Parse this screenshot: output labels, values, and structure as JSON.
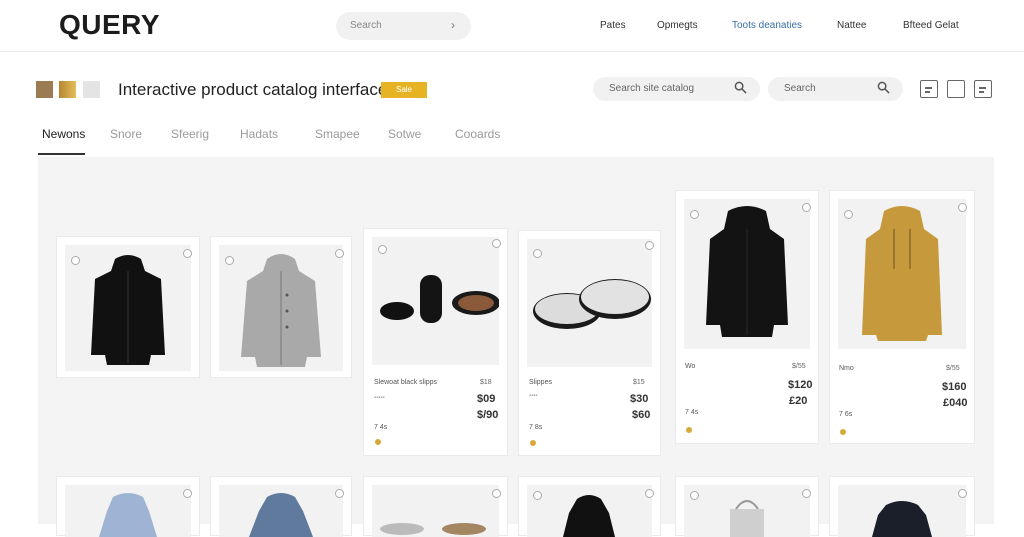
{
  "brand": {
    "logo": "QUERY"
  },
  "top_search": {
    "placeholder": "Search",
    "icon": "arrow-right-icon"
  },
  "nav": {
    "links": [
      {
        "label": "Pates"
      },
      {
        "label": "Opmegts"
      },
      {
        "label": "Toots deanaties"
      },
      {
        "label": "Nattee"
      },
      {
        "label": "Bfteed Gelat"
      }
    ],
    "active_index": 2
  },
  "header": {
    "swatches": [
      "#9b7b52",
      "#caa046",
      "#e4e4e4"
    ],
    "title": "Interactive product catalog interface",
    "tag": "Sale",
    "tag_color": "#e6b325",
    "search1_placeholder": "Search site catalog",
    "search2_placeholder": "Search",
    "view_icons": [
      "list-view-icon",
      "grid-view-icon",
      "list-view-icon"
    ]
  },
  "tabs": [
    {
      "label": "Newons"
    },
    {
      "label": "Snore"
    },
    {
      "label": "Sfeerig"
    },
    {
      "label": "Hadats"
    },
    {
      "label": "Smapee"
    },
    {
      "label": "Sotwe"
    },
    {
      "label": "Cooards"
    }
  ],
  "products": [
    {
      "image": "black-hooded-jacket",
      "name": "",
      "price": "",
      "price2": "",
      "meta": ""
    },
    {
      "image": "grey-hooded-parka",
      "name": "",
      "price": "",
      "price2": "",
      "meta": ""
    },
    {
      "image": "black-slippers",
      "name": "Slewoat black slipps",
      "price": "$18",
      "price2": "$09",
      "price3": "$/90",
      "sub": "▪▪▪▪▪",
      "meta": "7 4s"
    },
    {
      "image": "grey-slippers",
      "name": "Slippes",
      "price": "$15",
      "price2": "$30",
      "price3": "$60",
      "sub": "▪▪▪▪",
      "meta": "7 8s"
    },
    {
      "image": "black-fur-hoodie",
      "name": "Wo",
      "price": "$/55",
      "price2": "$120",
      "price3": "£20",
      "sub": "",
      "meta": "7 4s"
    },
    {
      "image": "mustard-hoodie",
      "name": "Nmo",
      "price": "$/55",
      "price2": "$160",
      "price3": "£040",
      "sub": "",
      "meta": "7 6s"
    }
  ]
}
